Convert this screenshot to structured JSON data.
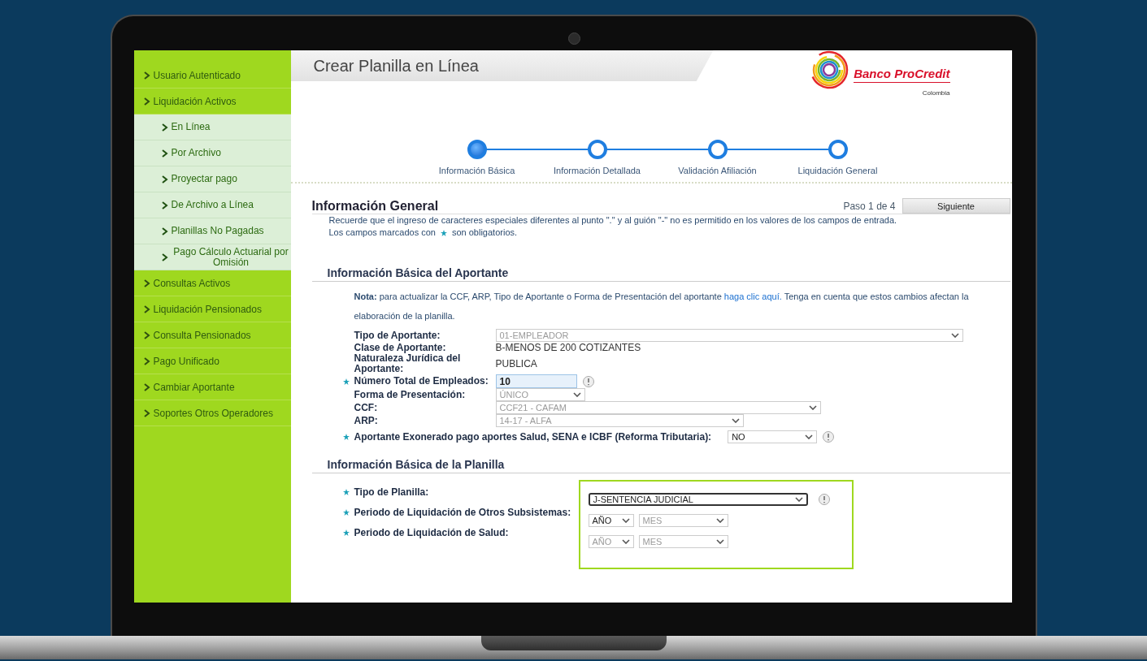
{
  "sidebar": {
    "items": [
      {
        "label": "Usuario Autenticado",
        "selected": false
      },
      {
        "label": "Liquidación Activos",
        "selected": false,
        "children": [
          {
            "label": "En Línea",
            "selected": false
          },
          {
            "label": "Por Archivo",
            "selected": false
          },
          {
            "label": "Proyectar pago",
            "selected": false
          },
          {
            "label": "De Archivo a Línea",
            "selected": false
          },
          {
            "label": "Planillas No Pagadas",
            "selected": false
          },
          {
            "label": "Pago Cálculo Actuarial por Omisión",
            "selected": false
          }
        ]
      },
      {
        "label": "Consultas Activos",
        "selected": false
      },
      {
        "label": "Liquidación Pensionados",
        "selected": false
      },
      {
        "label": "Consulta Pensionados",
        "selected": false
      },
      {
        "label": "Pago Unificado",
        "selected": false
      },
      {
        "label": "Cambiar Aportante",
        "selected": false
      },
      {
        "label": "Soportes Otros Operadores",
        "selected": false
      }
    ]
  },
  "page_title": "Crear Planilla en Línea",
  "logo": {
    "name": "Banco ProCredit",
    "country": "Colombia"
  },
  "steps": [
    {
      "label": "Información Básica",
      "selected": true
    },
    {
      "label": "Información Detallada",
      "selected": false
    },
    {
      "label": "Validación Afiliación",
      "selected": false
    },
    {
      "label": "Liquidación General",
      "selected": false
    }
  ],
  "general": {
    "title": "Información General",
    "step": "Paso 1 de 4",
    "next_button": "Siguiente",
    "notice": "Recuerde que el ingreso de caracteres especiales diferentes al punto \".\" y al guión \"-\" no es permitido en los valores de los campos de entrada.",
    "required_prefix": "Los campos marcados con",
    "required_suffix": "son obligatorios."
  },
  "aportante": {
    "title": "Información Básica del Aportante",
    "note_label": "Nota:",
    "note_text": "para actualizar la CCF, ARP, Tipo de Aportante o Forma de Presentación del aportante",
    "note_link": "haga clic aquí.",
    "note_tail": "Tenga en cuenta que estos cambios afectan la elaboración de la planilla.",
    "fields": [
      {
        "kind": "select",
        "label": "Tipo de Aportante:",
        "value": "01-EMPLEADOR",
        "disabled": true,
        "required": false,
        "help": false
      },
      {
        "kind": "text",
        "label": "Clase de Aportante:",
        "value": "B-MENOS DE 200 COTIZANTES",
        "required": false,
        "help": false
      },
      {
        "kind": "text",
        "label": "Naturaleza Jurídica del Aportante:",
        "value": "PUBLICA",
        "required": false,
        "help": false
      },
      {
        "kind": "input",
        "label": "Número Total de Empleados:",
        "value": "10",
        "required": true,
        "help": true
      },
      {
        "kind": "select",
        "label": "Forma de Presentación:",
        "value": "ÚNICO",
        "disabled": true,
        "required": false,
        "help": false
      },
      {
        "kind": "select",
        "label": "CCF:",
        "value": "CCF21 - CAFAM",
        "disabled": true,
        "required": false,
        "help": false
      },
      {
        "kind": "select",
        "label": "ARP:",
        "value": "14-17 - ALFA",
        "disabled": true,
        "required": false,
        "help": false
      },
      {
        "kind": "select",
        "label": "Aportante Exonerado pago aportes Salud, SENA e ICBF (Reforma Tributaria):",
        "value": "NO",
        "disabled": false,
        "required": true,
        "help": true
      }
    ]
  },
  "planilla": {
    "title": "Información Básica de la Planilla",
    "highlighted": true,
    "fields": [
      {
        "label": "Tipo de Planilla:",
        "required": true,
        "help": true,
        "controls": [
          {
            "value": "J-SENTENCIA JUDICIAL",
            "disabled": false,
            "focused": true
          }
        ]
      },
      {
        "label": "Periodo de Liquidación de Otros Subsistemas:",
        "required": true,
        "help": false,
        "controls": [
          {
            "value": "AÑO",
            "disabled": false,
            "focused": false
          },
          {
            "value": "MES",
            "disabled": true,
            "focused": false
          }
        ]
      },
      {
        "label": "Periodo de Liquidación de Salud:",
        "required": true,
        "help": false,
        "controls": [
          {
            "value": "AÑO",
            "disabled": true,
            "focused": false
          },
          {
            "value": "MES",
            "disabled": true,
            "focused": false
          }
        ]
      }
    ]
  }
}
